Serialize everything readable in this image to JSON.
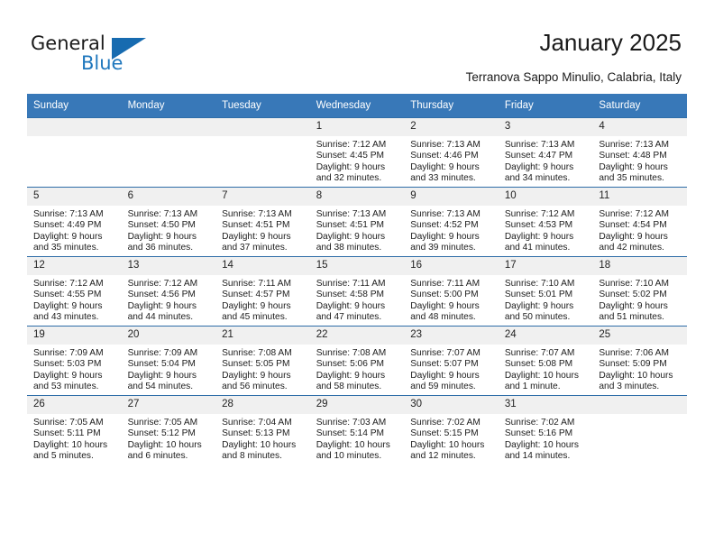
{
  "brand": {
    "name_part1": "General",
    "name_part2": "Blue",
    "accent_color": "#176bb0"
  },
  "header": {
    "title": "January 2025",
    "location": "Terranova Sappo Minulio, Calabria, Italy",
    "header_bg": "#3878b8"
  },
  "weekday_headers": [
    "Sunday",
    "Monday",
    "Tuesday",
    "Wednesday",
    "Thursday",
    "Friday",
    "Saturday"
  ],
  "weeks": [
    [
      {
        "day": "",
        "sunrise": "",
        "sunset": "",
        "daylight1": "",
        "daylight2": "",
        "empty": true
      },
      {
        "day": "",
        "sunrise": "",
        "sunset": "",
        "daylight1": "",
        "daylight2": "",
        "empty": true
      },
      {
        "day": "",
        "sunrise": "",
        "sunset": "",
        "daylight1": "",
        "daylight2": "",
        "empty": true
      },
      {
        "day": "1",
        "sunrise": "Sunrise: 7:12 AM",
        "sunset": "Sunset: 4:45 PM",
        "daylight1": "Daylight: 9 hours",
        "daylight2": "and 32 minutes."
      },
      {
        "day": "2",
        "sunrise": "Sunrise: 7:13 AM",
        "sunset": "Sunset: 4:46 PM",
        "daylight1": "Daylight: 9 hours",
        "daylight2": "and 33 minutes."
      },
      {
        "day": "3",
        "sunrise": "Sunrise: 7:13 AM",
        "sunset": "Sunset: 4:47 PM",
        "daylight1": "Daylight: 9 hours",
        "daylight2": "and 34 minutes."
      },
      {
        "day": "4",
        "sunrise": "Sunrise: 7:13 AM",
        "sunset": "Sunset: 4:48 PM",
        "daylight1": "Daylight: 9 hours",
        "daylight2": "and 35 minutes."
      }
    ],
    [
      {
        "day": "5",
        "sunrise": "Sunrise: 7:13 AM",
        "sunset": "Sunset: 4:49 PM",
        "daylight1": "Daylight: 9 hours",
        "daylight2": "and 35 minutes."
      },
      {
        "day": "6",
        "sunrise": "Sunrise: 7:13 AM",
        "sunset": "Sunset: 4:50 PM",
        "daylight1": "Daylight: 9 hours",
        "daylight2": "and 36 minutes."
      },
      {
        "day": "7",
        "sunrise": "Sunrise: 7:13 AM",
        "sunset": "Sunset: 4:51 PM",
        "daylight1": "Daylight: 9 hours",
        "daylight2": "and 37 minutes."
      },
      {
        "day": "8",
        "sunrise": "Sunrise: 7:13 AM",
        "sunset": "Sunset: 4:51 PM",
        "daylight1": "Daylight: 9 hours",
        "daylight2": "and 38 minutes."
      },
      {
        "day": "9",
        "sunrise": "Sunrise: 7:13 AM",
        "sunset": "Sunset: 4:52 PM",
        "daylight1": "Daylight: 9 hours",
        "daylight2": "and 39 minutes."
      },
      {
        "day": "10",
        "sunrise": "Sunrise: 7:12 AM",
        "sunset": "Sunset: 4:53 PM",
        "daylight1": "Daylight: 9 hours",
        "daylight2": "and 41 minutes."
      },
      {
        "day": "11",
        "sunrise": "Sunrise: 7:12 AM",
        "sunset": "Sunset: 4:54 PM",
        "daylight1": "Daylight: 9 hours",
        "daylight2": "and 42 minutes."
      }
    ],
    [
      {
        "day": "12",
        "sunrise": "Sunrise: 7:12 AM",
        "sunset": "Sunset: 4:55 PM",
        "daylight1": "Daylight: 9 hours",
        "daylight2": "and 43 minutes."
      },
      {
        "day": "13",
        "sunrise": "Sunrise: 7:12 AM",
        "sunset": "Sunset: 4:56 PM",
        "daylight1": "Daylight: 9 hours",
        "daylight2": "and 44 minutes."
      },
      {
        "day": "14",
        "sunrise": "Sunrise: 7:11 AM",
        "sunset": "Sunset: 4:57 PM",
        "daylight1": "Daylight: 9 hours",
        "daylight2": "and 45 minutes."
      },
      {
        "day": "15",
        "sunrise": "Sunrise: 7:11 AM",
        "sunset": "Sunset: 4:58 PM",
        "daylight1": "Daylight: 9 hours",
        "daylight2": "and 47 minutes."
      },
      {
        "day": "16",
        "sunrise": "Sunrise: 7:11 AM",
        "sunset": "Sunset: 5:00 PM",
        "daylight1": "Daylight: 9 hours",
        "daylight2": "and 48 minutes."
      },
      {
        "day": "17",
        "sunrise": "Sunrise: 7:10 AM",
        "sunset": "Sunset: 5:01 PM",
        "daylight1": "Daylight: 9 hours",
        "daylight2": "and 50 minutes."
      },
      {
        "day": "18",
        "sunrise": "Sunrise: 7:10 AM",
        "sunset": "Sunset: 5:02 PM",
        "daylight1": "Daylight: 9 hours",
        "daylight2": "and 51 minutes."
      }
    ],
    [
      {
        "day": "19",
        "sunrise": "Sunrise: 7:09 AM",
        "sunset": "Sunset: 5:03 PM",
        "daylight1": "Daylight: 9 hours",
        "daylight2": "and 53 minutes."
      },
      {
        "day": "20",
        "sunrise": "Sunrise: 7:09 AM",
        "sunset": "Sunset: 5:04 PM",
        "daylight1": "Daylight: 9 hours",
        "daylight2": "and 54 minutes."
      },
      {
        "day": "21",
        "sunrise": "Sunrise: 7:08 AM",
        "sunset": "Sunset: 5:05 PM",
        "daylight1": "Daylight: 9 hours",
        "daylight2": "and 56 minutes."
      },
      {
        "day": "22",
        "sunrise": "Sunrise: 7:08 AM",
        "sunset": "Sunset: 5:06 PM",
        "daylight1": "Daylight: 9 hours",
        "daylight2": "and 58 minutes."
      },
      {
        "day": "23",
        "sunrise": "Sunrise: 7:07 AM",
        "sunset": "Sunset: 5:07 PM",
        "daylight1": "Daylight: 9 hours",
        "daylight2": "and 59 minutes."
      },
      {
        "day": "24",
        "sunrise": "Sunrise: 7:07 AM",
        "sunset": "Sunset: 5:08 PM",
        "daylight1": "Daylight: 10 hours",
        "daylight2": "and 1 minute."
      },
      {
        "day": "25",
        "sunrise": "Sunrise: 7:06 AM",
        "sunset": "Sunset: 5:09 PM",
        "daylight1": "Daylight: 10 hours",
        "daylight2": "and 3 minutes."
      }
    ],
    [
      {
        "day": "26",
        "sunrise": "Sunrise: 7:05 AM",
        "sunset": "Sunset: 5:11 PM",
        "daylight1": "Daylight: 10 hours",
        "daylight2": "and 5 minutes."
      },
      {
        "day": "27",
        "sunrise": "Sunrise: 7:05 AM",
        "sunset": "Sunset: 5:12 PM",
        "daylight1": "Daylight: 10 hours",
        "daylight2": "and 6 minutes."
      },
      {
        "day": "28",
        "sunrise": "Sunrise: 7:04 AM",
        "sunset": "Sunset: 5:13 PM",
        "daylight1": "Daylight: 10 hours",
        "daylight2": "and 8 minutes."
      },
      {
        "day": "29",
        "sunrise": "Sunrise: 7:03 AM",
        "sunset": "Sunset: 5:14 PM",
        "daylight1": "Daylight: 10 hours",
        "daylight2": "and 10 minutes."
      },
      {
        "day": "30",
        "sunrise": "Sunrise: 7:02 AM",
        "sunset": "Sunset: 5:15 PM",
        "daylight1": "Daylight: 10 hours",
        "daylight2": "and 12 minutes."
      },
      {
        "day": "31",
        "sunrise": "Sunrise: 7:02 AM",
        "sunset": "Sunset: 5:16 PM",
        "daylight1": "Daylight: 10 hours",
        "daylight2": "and 14 minutes."
      },
      {
        "day": "",
        "sunrise": "",
        "sunset": "",
        "daylight1": "",
        "daylight2": "",
        "empty": true
      }
    ]
  ]
}
